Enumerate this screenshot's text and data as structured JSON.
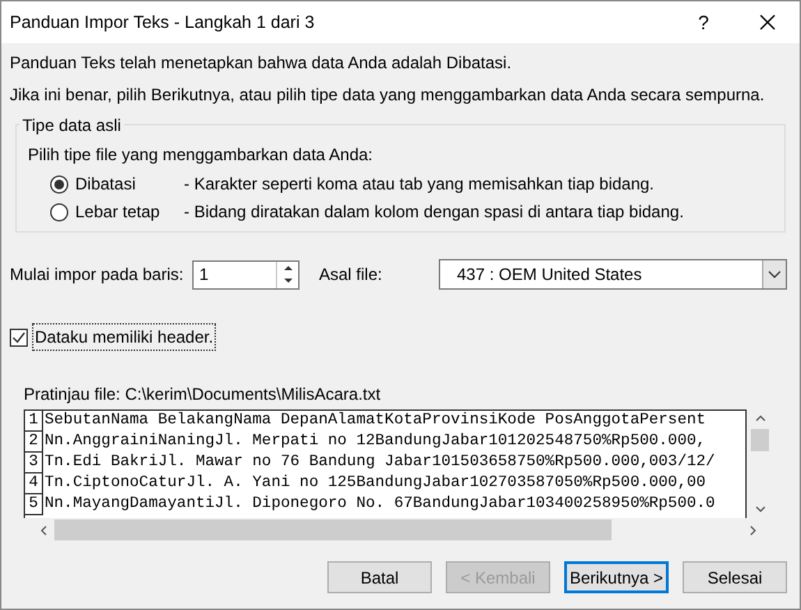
{
  "window": {
    "title": "Panduan Impor Teks - Langkah 1 dari 3",
    "help": "?"
  },
  "intro": [
    "Panduan Teks telah menetapkan bahwa data Anda adalah Dibatasi.",
    "Jika ini benar, pilih Berikutnya, atau pilih tipe data yang menggambarkan data Anda secara sempurna."
  ],
  "group": {
    "title": "Tipe data asli",
    "prompt": "Pilih tipe file yang menggambarkan data Anda:",
    "options": [
      {
        "label": "Dibatasi",
        "description": "- Karakter seperti koma atau tab yang memisahkan tiap bidang.",
        "selected": true
      },
      {
        "label": "Lebar tetap",
        "description": "- Bidang diratakan dalam kolom dengan spasi di antara tiap bidang.",
        "selected": false
      }
    ]
  },
  "start_row": {
    "label": "Mulai impor pada baris:",
    "value": "1"
  },
  "origin": {
    "label": "Asal file:",
    "value": "437 : OEM United States"
  },
  "header_checkbox": {
    "label": "Dataku memiliki header.",
    "checked": true
  },
  "preview": {
    "label": "Pratinjau file: C:\\kerim\\Documents\\MilisAcara.txt",
    "rows": [
      {
        "number": "1",
        "text": "SebutanNama BelakangNama DepanAlamatKotaProvinsiKode PosAnggotaPersent"
      },
      {
        "number": "2",
        "text": "Nn.AnggrainiNaningJl. Merpati no 12BandungJabar101202548750%Rp500.000,"
      },
      {
        "number": "3",
        "text": "Tn.Edi BakriJl. Mawar no 76 Bandung Jabar101503658750%Rp500.000,003/12/"
      },
      {
        "number": "4",
        "text": "Tn.CiptonoCaturJl. A. Yani no 125BandungJabar102703587050%Rp500.000,00"
      },
      {
        "number": "5",
        "text": "Nn.MayangDamayantiJl. Diponegoro No. 67BandungJabar103400258950%Rp500.0"
      }
    ]
  },
  "buttons": [
    {
      "label": "Batal",
      "disabled": false,
      "default": false
    },
    {
      "label": "< Kembali",
      "disabled": true,
      "default": false
    },
    {
      "label": "Berikutnya >",
      "disabled": false,
      "default": true
    },
    {
      "label": "Selesai",
      "disabled": false,
      "default": false
    }
  ]
}
